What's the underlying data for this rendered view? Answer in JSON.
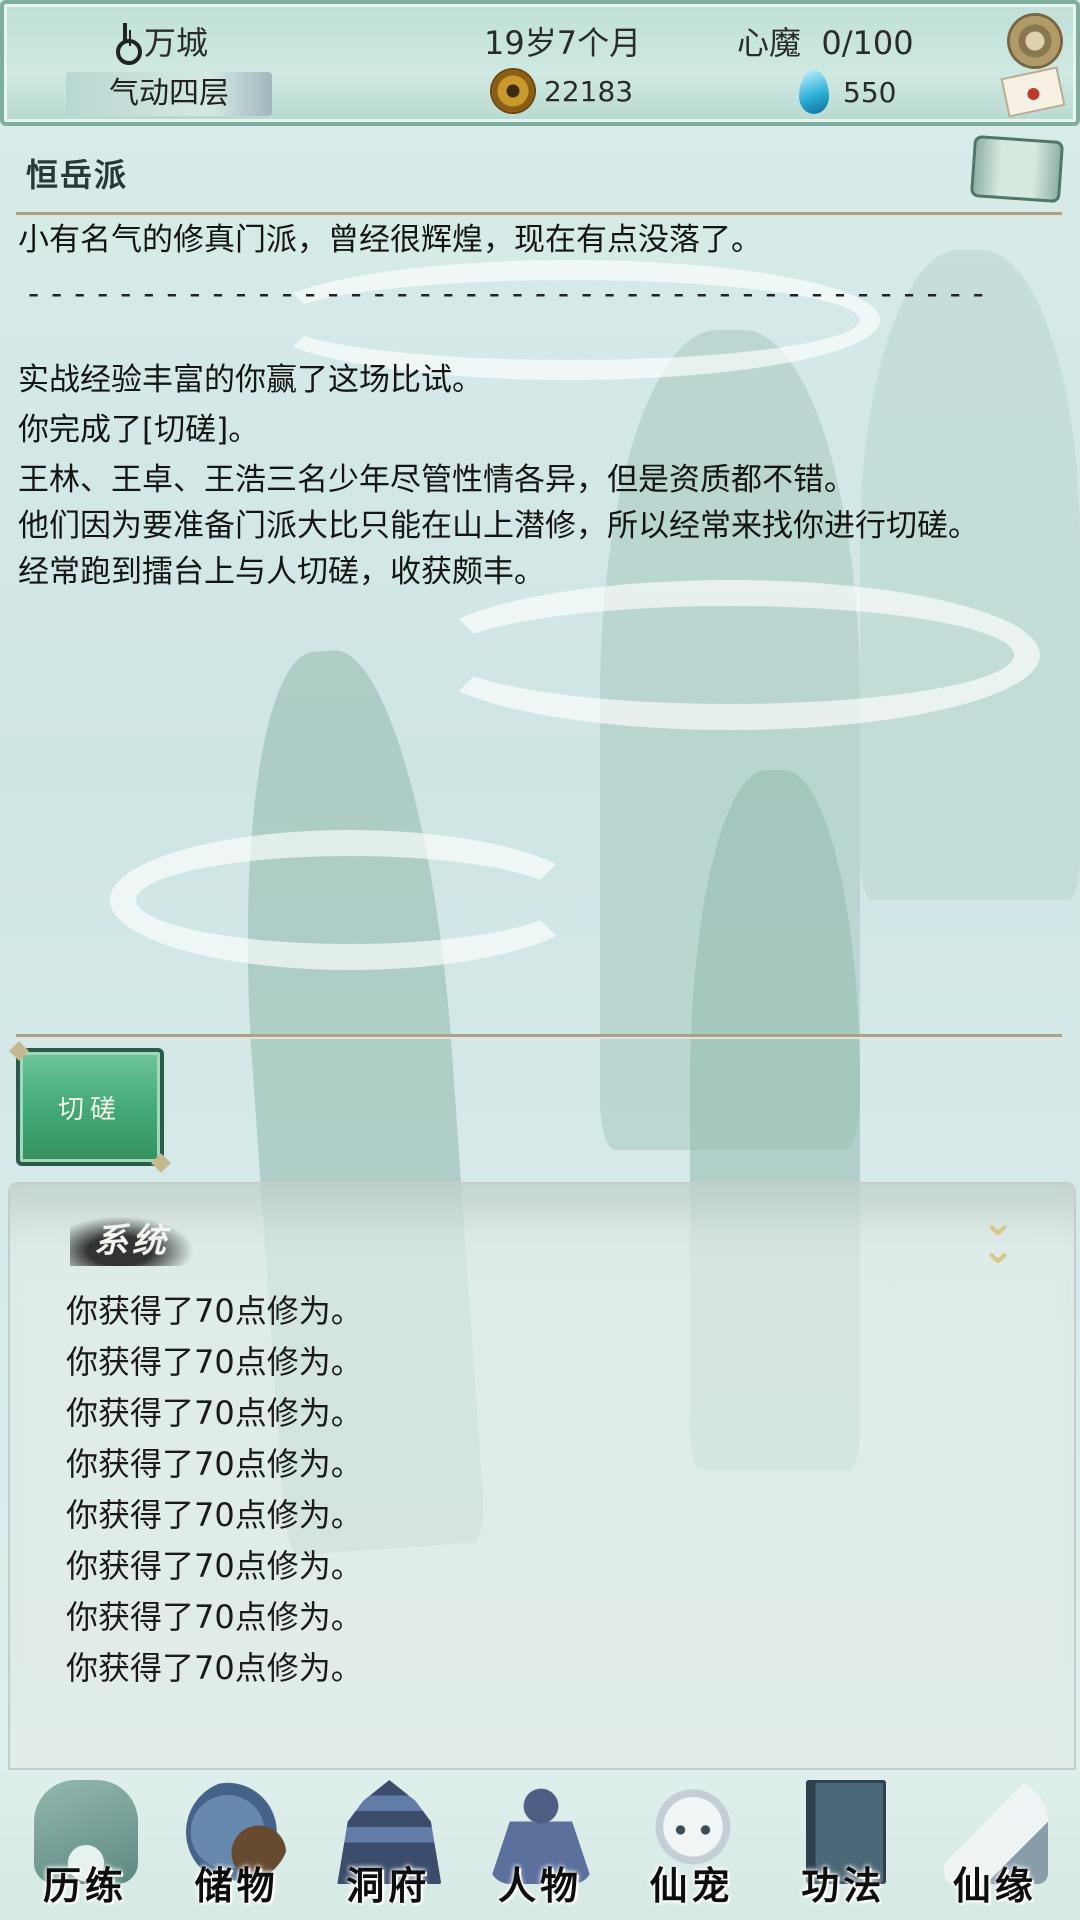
{
  "status": {
    "location": "万城",
    "realm": "气动四层",
    "age": "19岁7个月",
    "demon_label": "心魔",
    "demon_value": "0/100",
    "coins": "22183",
    "gems": "550"
  },
  "sect": {
    "name": "恒岳派",
    "description": "小有名气的修真门派，曾经很辉煌，现在有点没落了。",
    "divider": "- - - - - - - - - - - - - - - - - - - - - - - - - - - - - - - - - - - - - - - - - -"
  },
  "story": {
    "line1": "实战经验丰富的你赢了这场比试。",
    "line2": "你完成了[切磋]。",
    "line3": "王林、王卓、王浩三名少年尽管性情各异，但是资质都不错。",
    "line4": "他们因为要准备门派大比只能在山上潜修，所以经常来找你进行切磋。",
    "line5": "经常跑到擂台上与人切磋，收获颇丰。"
  },
  "action": {
    "label": "切磋"
  },
  "log": {
    "title": "系统",
    "collapse_icon": "chevron-double-down-icon",
    "entries": [
      "你获得了70点修为。",
      "你获得了70点修为。",
      "你获得了70点修为。",
      "你获得了70点修为。",
      "你获得了70点修为。",
      "你获得了70点修为。",
      "你获得了70点修为。",
      "你获得了70点修为。"
    ]
  },
  "nav": [
    {
      "label": "历练",
      "icon": "mountain-icon",
      "color": "#5f8f86"
    },
    {
      "label": "储物",
      "icon": "bag-icon",
      "color": "#6d5a3c"
    },
    {
      "label": "洞府",
      "icon": "pagoda-icon",
      "color": "#3e5478"
    },
    {
      "label": "人物",
      "icon": "character-icon",
      "color": "#4b5f86"
    },
    {
      "label": "仙宠",
      "icon": "spirit-pet-icon",
      "color": "#b8c4cc"
    },
    {
      "label": "功法",
      "icon": "book-icon",
      "color": "#3d5566"
    },
    {
      "label": "仙缘",
      "icon": "crane-icon",
      "color": "#8aa0ac"
    }
  ]
}
